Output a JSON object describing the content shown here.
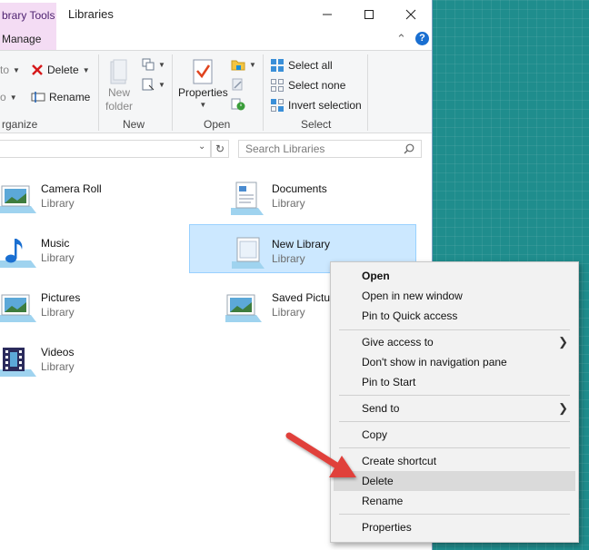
{
  "titlebar": {
    "context_tab": "brary Tools",
    "title": "Libraries"
  },
  "tabs": {
    "manage": "Manage"
  },
  "ribbon": {
    "clipboard_partial_1": "to",
    "clipboard_partial_2": "o",
    "organize": {
      "delete_label": "Delete",
      "rename_label": "Rename",
      "group_label": "rganize"
    },
    "new": {
      "new_folder_line1": "New",
      "new_folder_line2": "folder",
      "group_label": "New"
    },
    "open": {
      "properties_label": "Properties",
      "group_label": "Open"
    },
    "select": {
      "select_all": "Select all",
      "select_none": "Select none",
      "invert_selection": "Invert selection",
      "group_label": "Select"
    }
  },
  "address": {
    "search_placeholder": "Search Libraries"
  },
  "libraries": [
    {
      "name": "Camera Roll",
      "type": "Library",
      "icon": "pictures-library-icon"
    },
    {
      "name": "Documents",
      "type": "Library",
      "icon": "documents-library-icon"
    },
    {
      "name": "Music",
      "type": "Library",
      "icon": "music-library-icon"
    },
    {
      "name": "New Library",
      "type": "Library",
      "icon": "generic-library-icon",
      "selected": true
    },
    {
      "name": "Pictures",
      "type": "Library",
      "icon": "pictures-library-icon"
    },
    {
      "name": "Saved Pictur",
      "type": "Library",
      "icon": "pictures-library-icon"
    },
    {
      "name": "Videos",
      "type": "Library",
      "icon": "videos-library-icon"
    }
  ],
  "context_menu": {
    "open": "Open",
    "open_new_window": "Open in new window",
    "pin_quick_access": "Pin to Quick access",
    "give_access": "Give access to",
    "dont_show": "Don't show in navigation pane",
    "pin_start": "Pin to Start",
    "send_to": "Send to",
    "copy": "Copy",
    "create_shortcut": "Create shortcut",
    "delete": "Delete",
    "rename": "Rename",
    "properties": "Properties",
    "hovered_item": "Delete"
  },
  "colors": {
    "desktop": "#1f8d8d",
    "context_tab": "#f4dcf4",
    "selection": "#cce8ff",
    "menu_bg": "#f2f2f2",
    "menu_hover": "#dadada",
    "annotation_arrow": "#e0403a"
  }
}
